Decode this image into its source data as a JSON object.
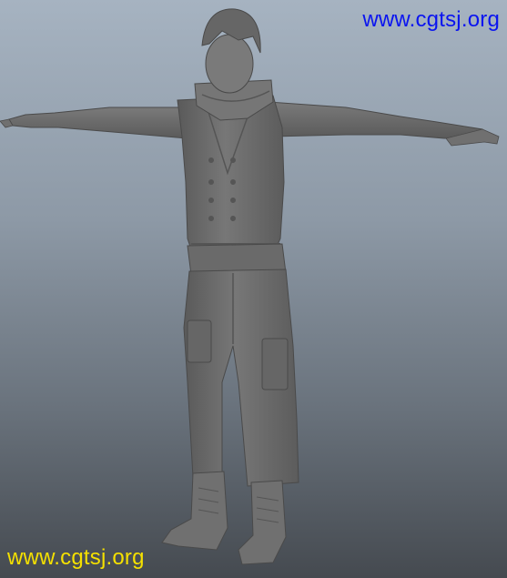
{
  "viewport": {
    "background_top": "#a6b3c1",
    "background_bottom": "#454a50",
    "model_color": "#6f6f6f",
    "subject": "t-pose-character-model"
  },
  "watermarks": {
    "top_text": "www.cgtsj.org",
    "top_color": "#0a14f0",
    "bottom_text": "www.cgtsj.org",
    "bottom_color": "#f5e000"
  }
}
